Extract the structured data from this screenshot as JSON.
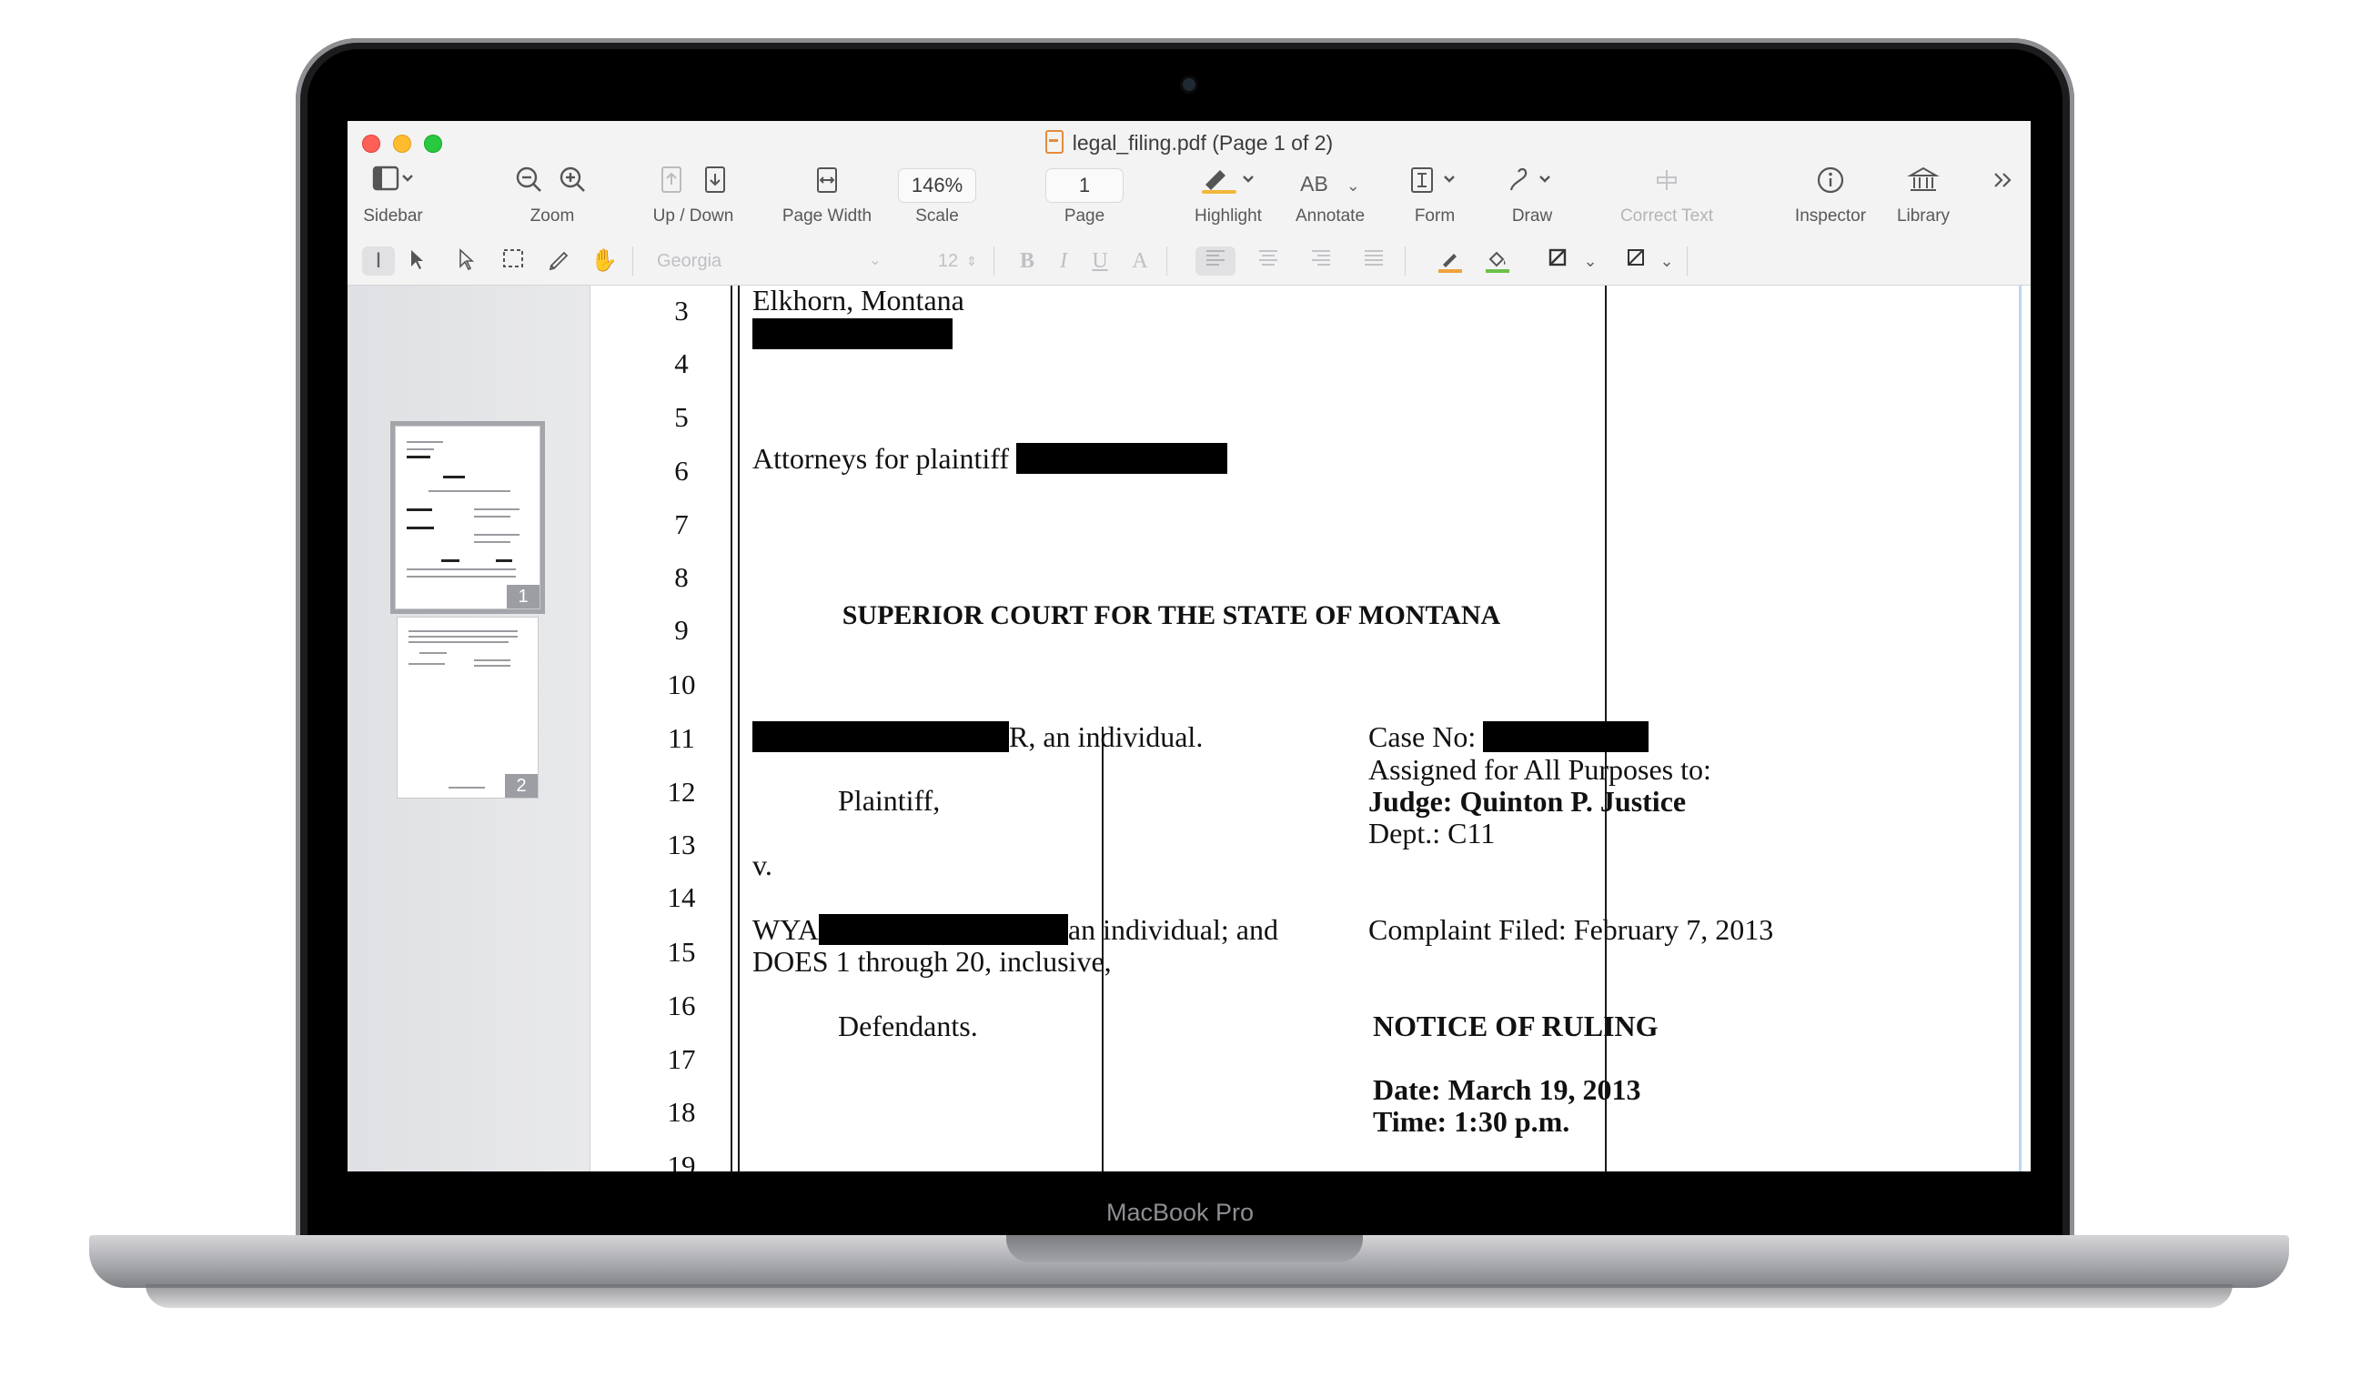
{
  "device": {
    "label": "MacBook Pro"
  },
  "window": {
    "title": "legal_filing.pdf (Page 1 of 2)"
  },
  "toolbar": {
    "sidebar_label": "Sidebar",
    "zoom_label": "Zoom",
    "updown_label": "Up / Down",
    "pagewidth_label": "Page Width",
    "scale_value": "146%",
    "scale_label": "Scale",
    "page_value": "1",
    "page_label": "Page",
    "highlight_label": "Highlight",
    "annotate_glyph": "AB",
    "annotate_label": "Annotate",
    "form_label": "Form",
    "draw_label": "Draw",
    "correct_text_label": "Correct Text",
    "inspector_label": "Inspector",
    "library_label": "Library"
  },
  "format_bar": {
    "font": "Georgia",
    "size": "12",
    "bold": "B",
    "italic": "I",
    "underline": "U",
    "color": "A"
  },
  "sidebar": {
    "thumbnails": [
      {
        "page": "1",
        "selected": true
      },
      {
        "page": "2",
        "selected": false
      }
    ]
  },
  "document": {
    "line_numbers": [
      "3",
      "4",
      "5",
      "6",
      "7",
      "8",
      "9",
      "10",
      "11",
      "12",
      "13",
      "14",
      "15",
      "16",
      "17",
      "18",
      "19"
    ],
    "address_line": "Elkhorn, Montana",
    "attorneys": "Attorneys for plaintiff",
    "court_heading": "SUPERIOR COURT FOR THE STATE OF MONTANA",
    "plaintiff_name_suffix": "R, an individual.",
    "plaintiff_role": "Plaintiff,",
    "versus": "v.",
    "defendant_prefix": "WYA",
    "defendant_suffix": "an individual; and",
    "does_line": "DOES 1 through 20, inclusive,",
    "defendant_role": "Defendants.",
    "case_no_label": "Case No:",
    "assigned": "Assigned for All Purposes to:",
    "judge": "Judge: Quinton P. Justice",
    "dept": "Dept.: C11",
    "complaint_filed": "Complaint Filed: February 7, 2013",
    "notice": "NOTICE OF RULING",
    "date": "Date: March 19, 2013",
    "time": "Time: 1:30 p.m."
  }
}
